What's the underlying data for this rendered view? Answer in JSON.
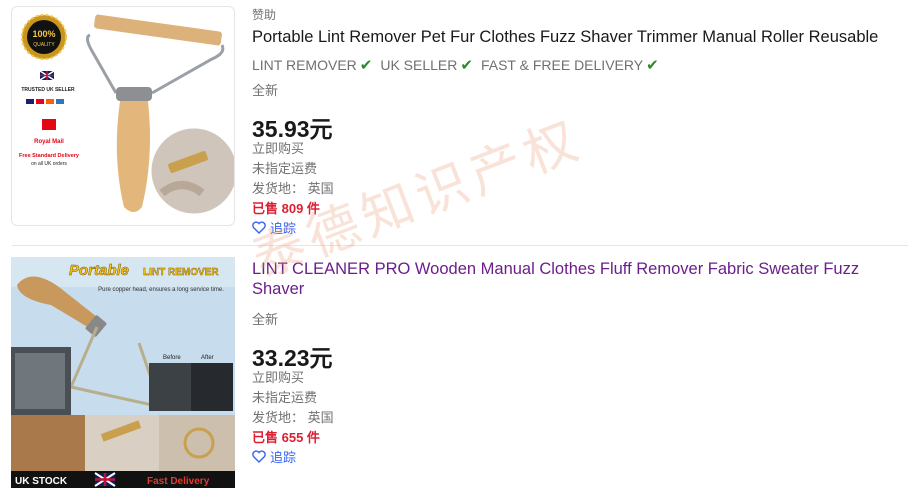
{
  "listings": [
    {
      "sponsored": "赞助",
      "title": "Portable Lint Remover Pet Fur Clothes Fuzz Shaver Trimmer Manual Roller Reusable",
      "subtitle": [
        "LINT REMOVER",
        "UK SELLER",
        "FAST & FREE DELIVERY"
      ],
      "condition": "全新",
      "price": "35.93元",
      "buy_format": "立即购买",
      "shipping": "未指定运费",
      "location": "发货地： 英国",
      "sold": "已售 809 件",
      "watch": "追踪",
      "image": {
        "badge": "100%",
        "badge_sub": "QUALITY",
        "trusted": "TRUSTED UK SELLER",
        "royal_mail": "Royal Mail",
        "free_delivery": "Free Standard Delivery",
        "free_delivery_sub": "on all UK orders"
      }
    },
    {
      "title": "LINT CLEANER PRO Wooden Manual Clothes Fluff Remover Fabric Sweater Fuzz Shaver",
      "condition": "全新",
      "price": "33.23元",
      "buy_format": "立即购买",
      "shipping": "未指定运费",
      "location": "发货地： 英国",
      "sold": "已售 655 件",
      "watch": "追踪",
      "image": {
        "headline_a": "Portable",
        "headline_b": "LINT REMOVER",
        "caption": "Pure copper head, ensures a long service time.",
        "before": "Before",
        "after": "After",
        "footer_left": "UK STOCK",
        "footer_right": "Fast Delivery"
      }
    }
  ],
  "watermark": "泰德知识产权",
  "colors": {
    "price": "#191919",
    "sold": "#dd1e31",
    "link": "#3665f3",
    "visited": "#6b1f8a",
    "check": "#2a8a2a"
  }
}
